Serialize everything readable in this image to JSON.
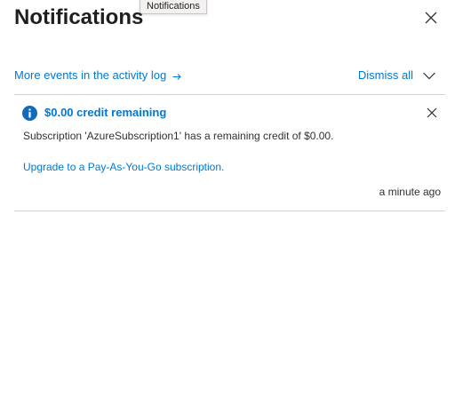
{
  "tooltip": {
    "text": "Notifications"
  },
  "header": {
    "title": "Notifications"
  },
  "toolbar": {
    "activity_link": "More events in the activity log",
    "arrow_glyph": "→",
    "dismiss_all": "Dismiss all"
  },
  "notification": {
    "title": "$0.00 credit remaining",
    "body": "Subscription 'AzureSubscription1' has a remaining credit of $0.00.",
    "upgrade_link": "Upgrade to a Pay-As-You-Go subscription.",
    "time": "a minute ago",
    "icon": "info-icon"
  },
  "colors": {
    "link": "#0078d4",
    "text": "#323130",
    "divider": "#d2d0ce",
    "info": "#0f6cbd"
  }
}
